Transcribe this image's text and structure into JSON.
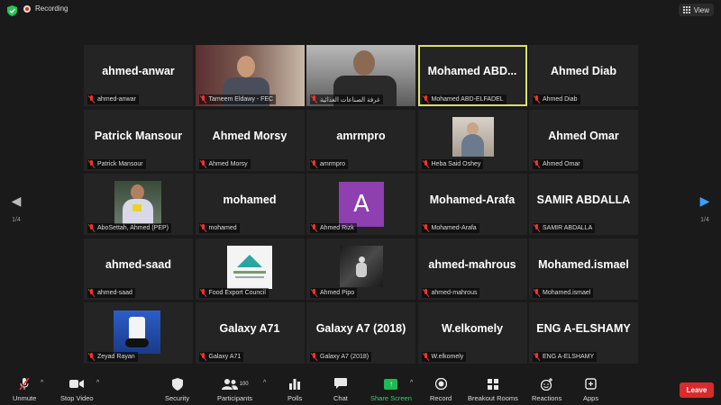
{
  "topbar": {
    "recording_label": "Recording",
    "view_label": "View"
  },
  "pager": {
    "left_page": "1/4",
    "right_page": "1/4"
  },
  "tiles": [
    {
      "name": "ahmed-anwar",
      "label": "ahmed-anwar",
      "type": "name"
    },
    {
      "name": "",
      "label": "Tameem Eldawy - FEC",
      "type": "video",
      "video": "vid-1"
    },
    {
      "name": "",
      "label": "غرفة الصناعات الغذائية",
      "type": "video",
      "video": "vid-2"
    },
    {
      "name": "Mohamed  ABD...",
      "label": "Mohamed ABD-ELFADEL",
      "type": "name",
      "active": true
    },
    {
      "name": "Ahmed Diab",
      "label": "Ahmed Diab",
      "type": "name"
    },
    {
      "name": "Patrick Mansour",
      "label": "Patrick Mansour",
      "type": "name"
    },
    {
      "name": "Ahmed Morsy",
      "label": "Ahmed Morsy",
      "type": "name"
    },
    {
      "name": "amrmpro",
      "label": "amrmpro",
      "type": "name"
    },
    {
      "name": "",
      "label": "Heba Said Oshey",
      "type": "photo",
      "photo": "heba"
    },
    {
      "name": "Ahmed Omar",
      "label": "Ahmed Omar",
      "type": "name"
    },
    {
      "name": "",
      "label": "AboSettah, Ahmed (PEP)",
      "type": "photo",
      "photo": "abosettah"
    },
    {
      "name": "mohamed",
      "label": "mohamed",
      "type": "name"
    },
    {
      "name": "",
      "label": "Ahmed Rizk",
      "type": "avatar",
      "letter": "A"
    },
    {
      "name": "Mohamed-Arafa",
      "label": "Mohamed-Arafa",
      "type": "name"
    },
    {
      "name": "SAMIR ABDALLA",
      "label": "SAMIR ABDALLA",
      "type": "name"
    },
    {
      "name": "ahmed-saad",
      "label": "ahmed-saad",
      "type": "name"
    },
    {
      "name": "",
      "label": "Food Export Council",
      "type": "photo",
      "photo": "fec"
    },
    {
      "name": "",
      "label": "Ahmed Pipo",
      "type": "photo",
      "photo": "pipo"
    },
    {
      "name": "ahmed-mahrous",
      "label": "ahmed-mahrous",
      "type": "name"
    },
    {
      "name": "Mohamed.ismael",
      "label": "Mohamed.ismael",
      "type": "name"
    },
    {
      "name": "",
      "label": "Zeyad Rayan",
      "type": "photo",
      "photo": "zeyad"
    },
    {
      "name": "Galaxy A71",
      "label": "Galaxy A71",
      "type": "name"
    },
    {
      "name": "Galaxy A7 (2018)",
      "label": "Galaxy A7 (2018)",
      "type": "name"
    },
    {
      "name": "W.elkomely",
      "label": "W.elkomely",
      "type": "name"
    },
    {
      "name": "ENG A-ELSHAMY",
      "label": "ENG A-ELSHAMY",
      "type": "name"
    }
  ],
  "toolbar": {
    "unmute": "Unmute",
    "stop_video": "Stop Video",
    "security": "Security",
    "participants": "Participants",
    "participants_count": "100",
    "polls": "Polls",
    "chat": "Chat",
    "share_screen": "Share Screen",
    "record": "Record",
    "breakout_rooms": "Breakout Rooms",
    "reactions": "Reactions",
    "apps": "Apps",
    "leave": "Leave"
  },
  "colors": {
    "active_speaker_border": "#d8e06a",
    "muted_mic": "#ee3333",
    "share_green": "#1db954",
    "leave_red": "#d92b2b",
    "pager_arrow": "#3aa0ff",
    "avatar_purple": "#8e3fb0"
  }
}
